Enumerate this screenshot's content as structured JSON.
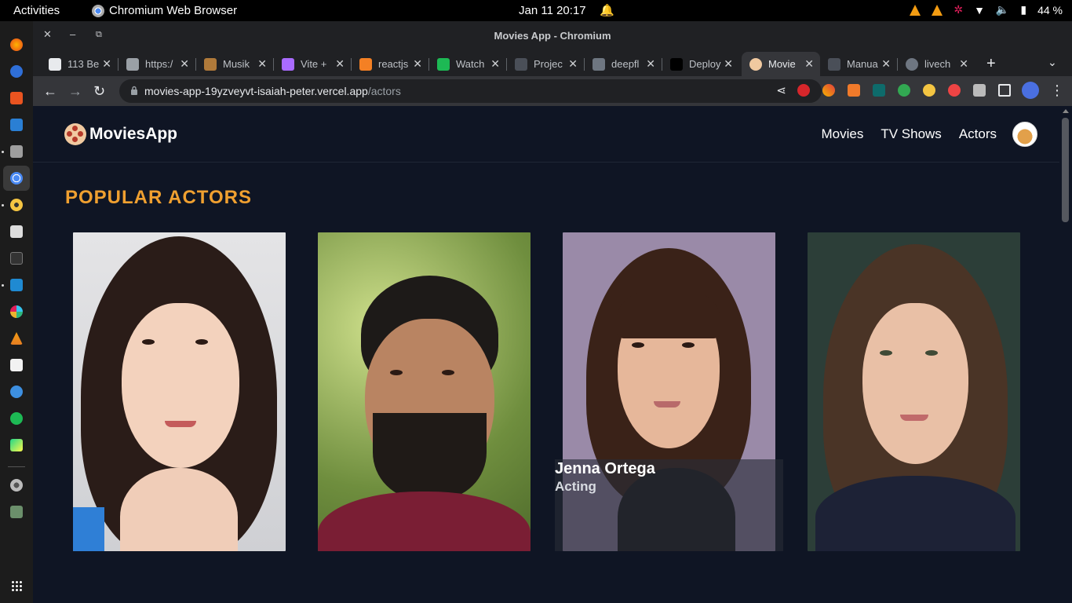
{
  "system": {
    "activities": "Activities",
    "app_name": "Chromium Web Browser",
    "clock": "Jan 11  20:17",
    "battery": "44 %"
  },
  "window": {
    "title": "Movies App - Chromium"
  },
  "tabs": [
    {
      "label": "113 Be",
      "favicon_color": "#e8eaed"
    },
    {
      "label": "https:/",
      "favicon_color": "#9aa0a6"
    },
    {
      "label": "Musik",
      "favicon_color": "#b07a3a"
    },
    {
      "label": "Vite +",
      "favicon_color": "#a96bff"
    },
    {
      "label": "reactjs",
      "favicon_color": "#f48024"
    },
    {
      "label": "Watch",
      "favicon_color": "#1db954"
    },
    {
      "label": "Projec",
      "favicon_color": "#4a4f58"
    },
    {
      "label": "deepfl",
      "favicon_color": "#6e7681"
    },
    {
      "label": "Deploy",
      "favicon_color": "#000000"
    },
    {
      "label": "Movie",
      "favicon_color": "#f0c9a0",
      "selected": true
    },
    {
      "label": "Manua",
      "favicon_color": "#4a4f58"
    },
    {
      "label": "livech",
      "favicon_color": "#6e7681"
    }
  ],
  "omnibox": {
    "host": "movies-app-19yzveyvt-isaiah-peter.vercel.app",
    "path": "/actors"
  },
  "app": {
    "brand": "MoviesApp",
    "nav": {
      "movies": "Movies",
      "tv_shows": "TV Shows",
      "actors": "Actors"
    },
    "heading": "POPULAR ACTORS",
    "actors": [
      {
        "name": "",
        "department": ""
      },
      {
        "name": "",
        "department": ""
      },
      {
        "name": "Jenna Ortega",
        "department": "Acting",
        "hovered": true
      },
      {
        "name": "",
        "department": ""
      }
    ]
  },
  "colors": {
    "page_bg": "#0f1524",
    "accent": "#f0a030"
  }
}
